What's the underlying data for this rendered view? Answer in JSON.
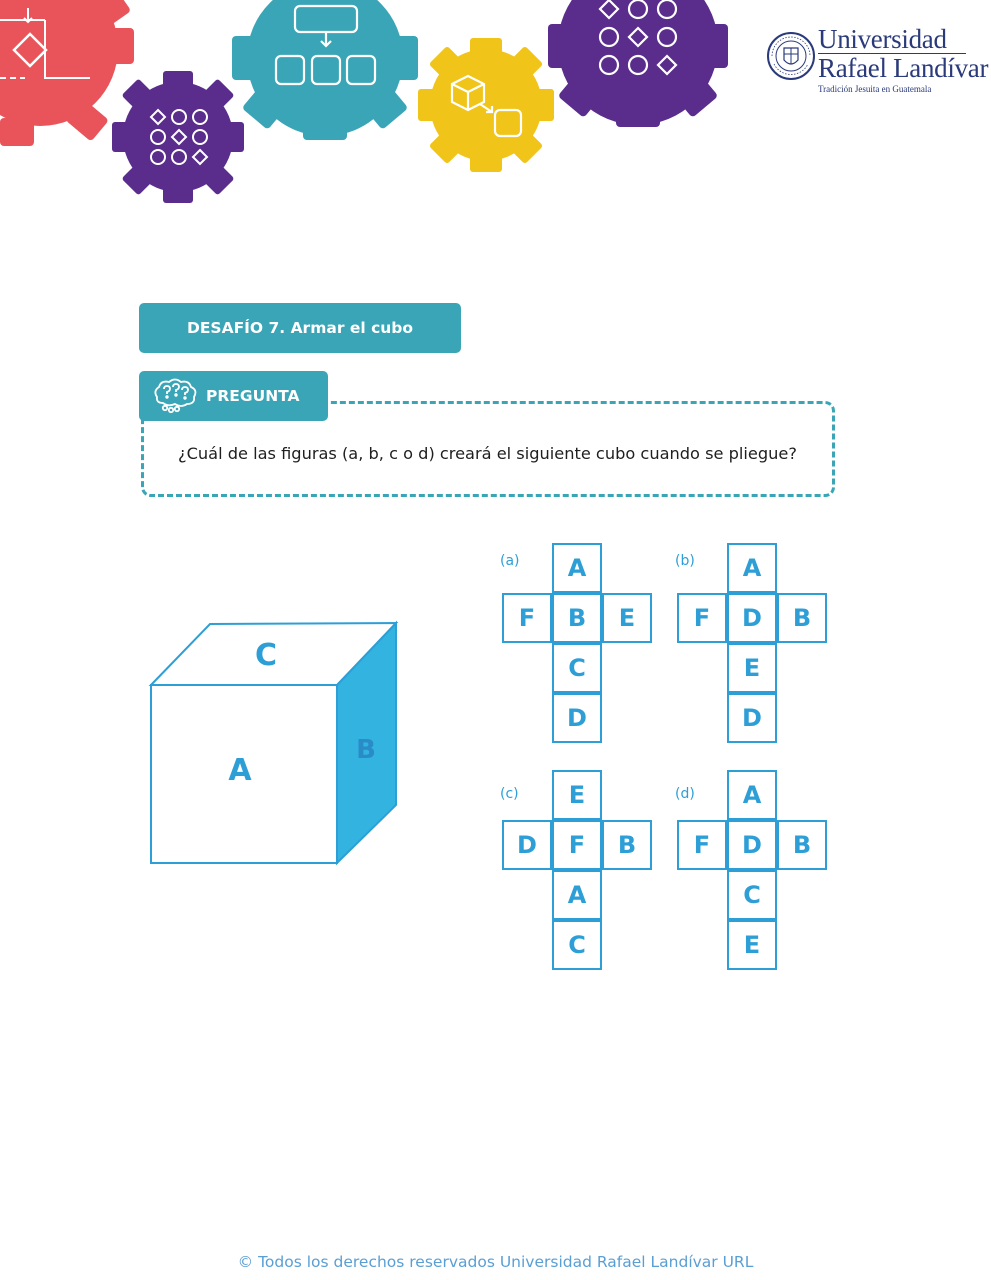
{
  "header": {
    "logo": {
      "name_line1": "Universidad",
      "name_line2": "Rafael Landívar",
      "tagline": "Tradición Jesuita en Guatemala",
      "seal_text": "Universidad Rafael Landívar"
    },
    "gear_colors": [
      "#e9545a",
      "#5a2d8c",
      "#3aa5b6",
      "#f0c419",
      "#5a2d8c"
    ]
  },
  "challenge": {
    "title": "DESAFÍO 7. Armar el cubo"
  },
  "question": {
    "tab_label": "PREGUNTA",
    "text": "¿Cuál de las figuras (a, b, c o d) creará el siguiente cubo cuando se pliegue?"
  },
  "cube": {
    "front": "A",
    "top": "C",
    "side": "B"
  },
  "options": [
    {
      "label": "(a)",
      "top": "A",
      "left": "F",
      "center": "B",
      "right": "E",
      "below1": "C",
      "below2": "D"
    },
    {
      "label": "(b)",
      "top": "A",
      "left": "F",
      "center": "D",
      "right": "B",
      "below1": "E",
      "below2": "D"
    },
    {
      "label": "(c)",
      "top": "E",
      "left": "D",
      "center": "F",
      "right": "B",
      "below1": "A",
      "below2": "C"
    },
    {
      "label": "(d)",
      "top": "A",
      "left": "F",
      "center": "D",
      "right": "B",
      "below1": "C",
      "below2": "E"
    }
  ],
  "colors": {
    "teal": "#3aa5b6",
    "net_blue": "#2e9fd6",
    "cube_side": "#33b3e0",
    "logo_navy": "#2a3a7a"
  },
  "footer": {
    "text": "© Todos los derechos reservados Universidad Rafael Landívar URL"
  }
}
